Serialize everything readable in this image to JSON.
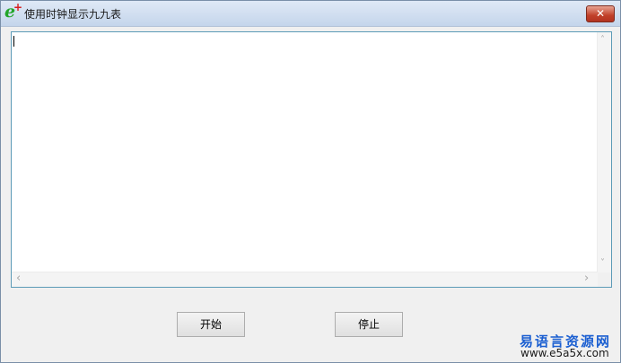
{
  "window": {
    "title": "使用时钟显示九九表",
    "close_glyph": "✕"
  },
  "icons": {
    "app_icon_letter": "e",
    "app_icon_plus": "+",
    "scroll_up": "˄",
    "scroll_down": "˅",
    "scroll_left": "‹",
    "scroll_right": "›"
  },
  "editor": {
    "value": ""
  },
  "buttons": {
    "start_label": "开始",
    "stop_label": "停止"
  },
  "watermark": {
    "name": "易语言资源网",
    "url": "www.e5a5x.com"
  }
}
